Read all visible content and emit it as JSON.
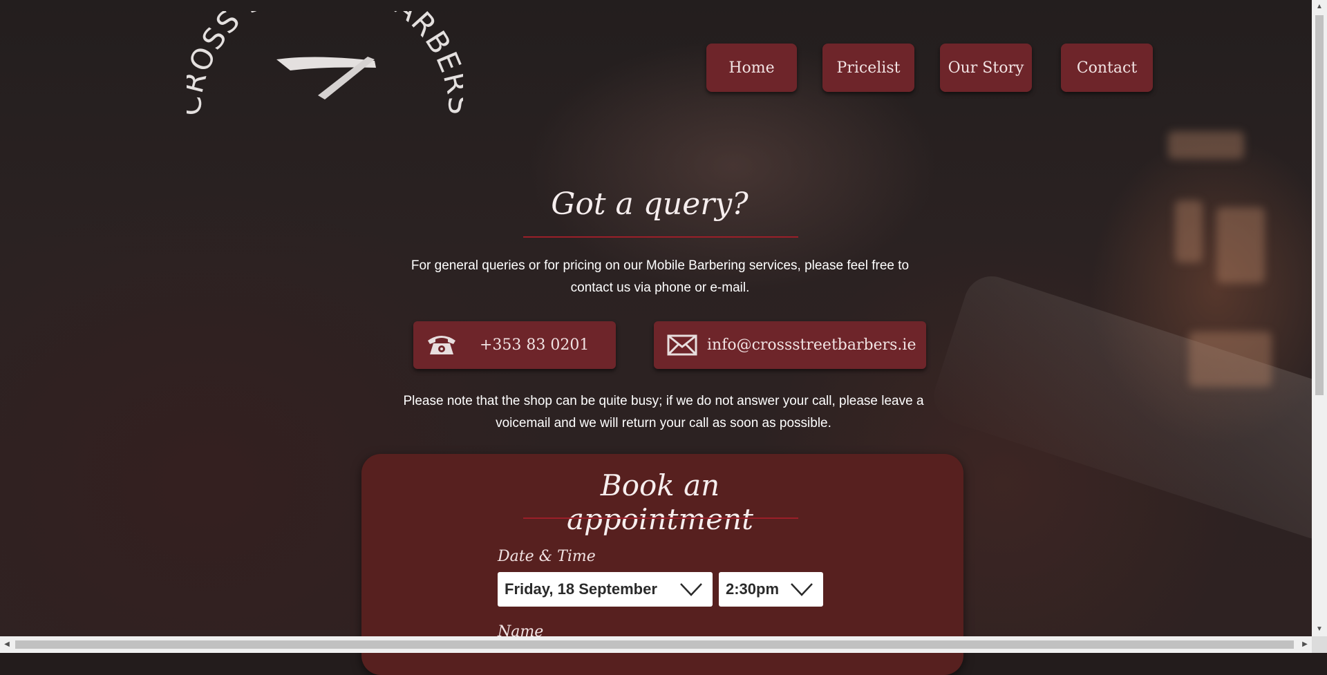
{
  "logo": {
    "text": "CROSS STREET BARBERS"
  },
  "nav": {
    "home": "Home",
    "pricelist": "Pricelist",
    "our_story": "Our Story",
    "contact": "Contact"
  },
  "query": {
    "title": "Got a query?",
    "intro": "For general queries or for pricing on our Mobile Barbering services, please feel free to contact us via phone or e-mail.",
    "phone": "+353 83 0201",
    "email": "info@crossstreetbarbers.ie",
    "note": "Please note that the shop can be quite busy; if we do not answer your call, please leave a voicemail and we will return your call as soon as possible."
  },
  "booking": {
    "title": "Book an appointment",
    "date_time_label": "Date & Time",
    "date_value": "Friday, 18 September",
    "time_value": "2:30pm",
    "name_label": "Name"
  },
  "icons": {
    "phone": "phone-icon",
    "email": "envelope-icon",
    "dropdown": "chevron-down-icon"
  },
  "colors": {
    "accent": "#6e252a",
    "booking_panel": "#57201f",
    "rule": "#9b1f29"
  }
}
